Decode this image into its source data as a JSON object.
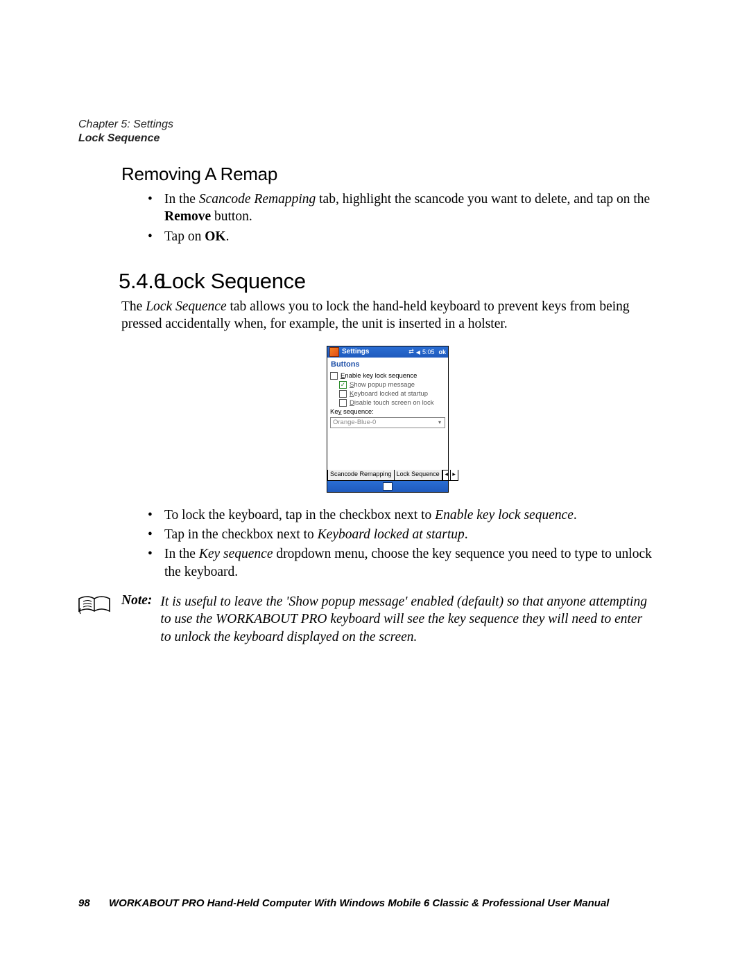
{
  "running_head": {
    "chapter": "Chapter 5: Settings",
    "section": "Lock Sequence"
  },
  "h_removing": "Removing A Remap",
  "remove_bullets": {
    "b1_pre": "In the ",
    "b1_i": "Scancode Remapping",
    "b1_mid": " tab, highlight the scancode you want to delete, and tap on the ",
    "b1_b": "Remove",
    "b1_post": " button.",
    "b2_pre": "Tap on ",
    "b2_b": "OK",
    "b2_post": "."
  },
  "h_lock": {
    "num": "5.4.6",
    "title": "Lock Sequence"
  },
  "lock_intro": {
    "pre": "The ",
    "i": "Lock Sequence",
    "post": " tab allows you to lock the hand-held keyboard to prevent keys from being pressed accidentally when, for example, the unit is inserted in a holster."
  },
  "wm": {
    "title": "Settings",
    "time": "5:05",
    "ok": "ok",
    "subtitle": "Buttons",
    "opt_enable_u": "E",
    "opt_enable": "nable key lock sequence",
    "opt_popup_u": "S",
    "opt_popup": "how popup message",
    "opt_startup_u": "K",
    "opt_startup": "eyboard locked at startup",
    "opt_touch_u": "D",
    "opt_touch": "isable touch screen on lock",
    "keyseq_label_pre": "Ke",
    "keyseq_label_u": "y",
    "keyseq_label_post": " sequence:",
    "keyseq_value": "Orange-Blue-0",
    "tab1": "Scancode Remapping",
    "tab2": "Lock Sequence",
    "scroll_l": "◂",
    "scroll_r": "▸"
  },
  "lock_bullets": {
    "b1_pre": "To lock the keyboard, tap in the checkbox next to ",
    "b1_i": "Enable key lock sequence",
    "b1_post": ".",
    "b2_pre": "Tap in the checkbox next to ",
    "b2_i": "Keyboard locked at startup",
    "b2_post": ".",
    "b3_pre": "In the ",
    "b3_i": "Key sequence",
    "b3_post": " dropdown menu, choose the key sequence you need to type to unlock the keyboard."
  },
  "note": {
    "label": "Note:",
    "text": "It is useful to leave the 'Show popup message' enabled (default) so that anyone attempting to use the WORKABOUT PRO keyboard will see the key sequence they will need to enter to unlock the keyboard displayed on the screen."
  },
  "footer": {
    "page": "98",
    "text": "WORKABOUT PRO Hand-Held Computer With Windows Mobile 6 Classic & Professional User Manual"
  }
}
